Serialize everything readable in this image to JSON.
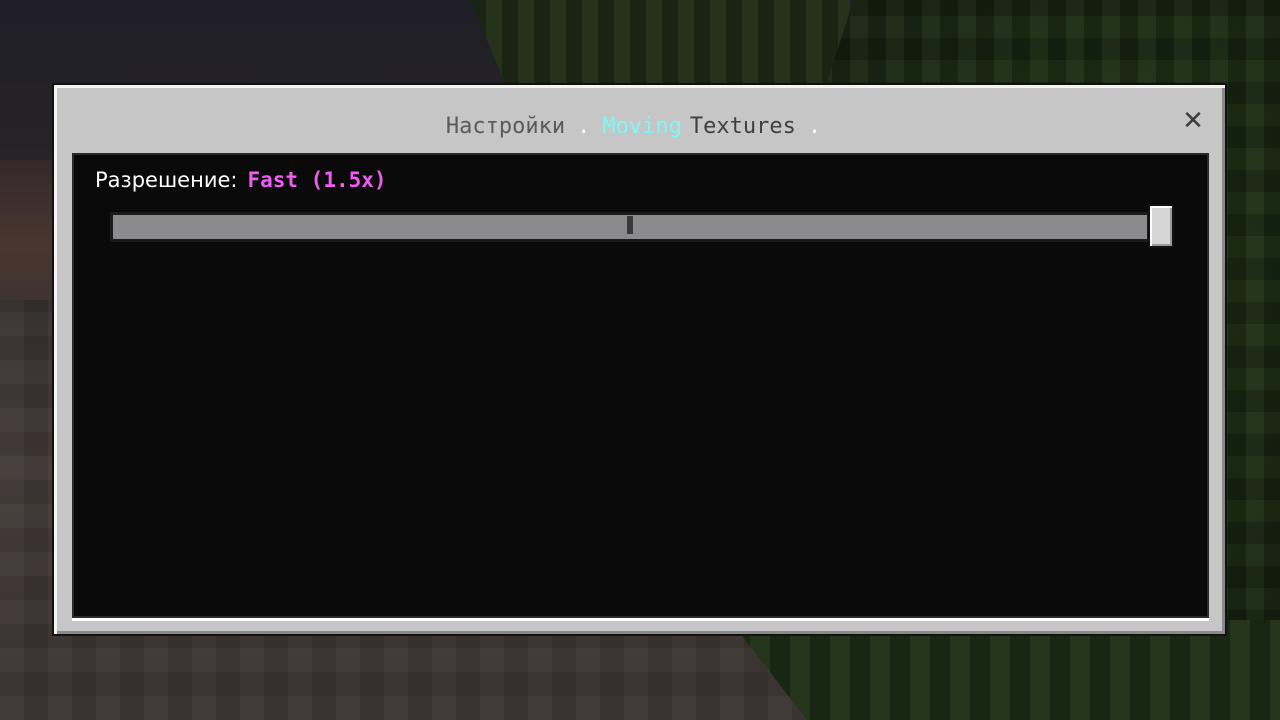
{
  "breadcrumb": {
    "root": "Настройки",
    "separator": ".",
    "accent": "Moving",
    "rest": "Textures",
    "trailing_separator": "."
  },
  "close_label": "✕",
  "setting": {
    "label": "Разрешение:",
    "value": "Fast (1.5x)",
    "slider_value_fraction": 1.0,
    "slider_ticks": [
      0.5
    ]
  },
  "colors": {
    "dialog_bg": "#c6c6c6",
    "content_bg": "#0b0a0b",
    "accent_cyan": "#7ff7f7",
    "value_magenta": "#f05cf5",
    "track_gray": "#8b8a8c"
  }
}
